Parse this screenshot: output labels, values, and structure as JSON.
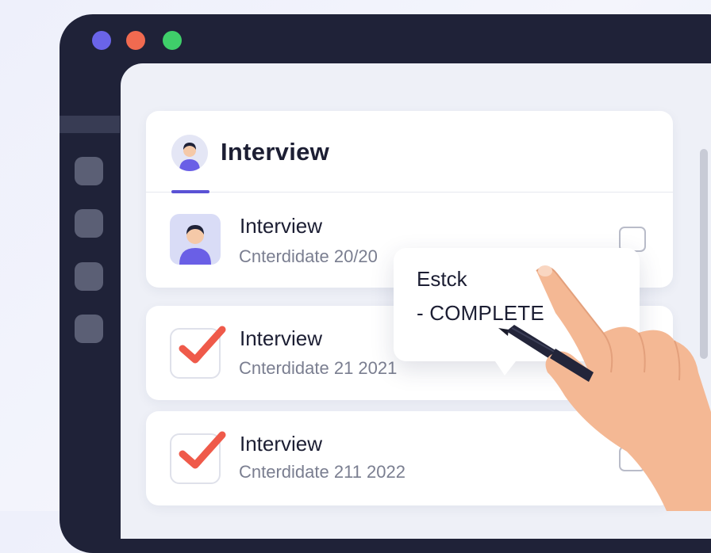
{
  "header": {
    "title": "Interview"
  },
  "items": [
    {
      "title": "Interview",
      "subtitle": "Cnterdidate 20/20",
      "checked": false
    },
    {
      "title": "Interview",
      "subtitle": "Cnterdidate 21 2021",
      "checked": true
    },
    {
      "title": "Interview",
      "subtitle": "Cnterdidate 211 2022",
      "checked": true
    }
  ],
  "tooltip": {
    "title": "Estck",
    "status": "- COMPLETE"
  },
  "colors": {
    "accent": "#5a52d5",
    "check": "#ef5a4a",
    "window": "#1f2238"
  }
}
